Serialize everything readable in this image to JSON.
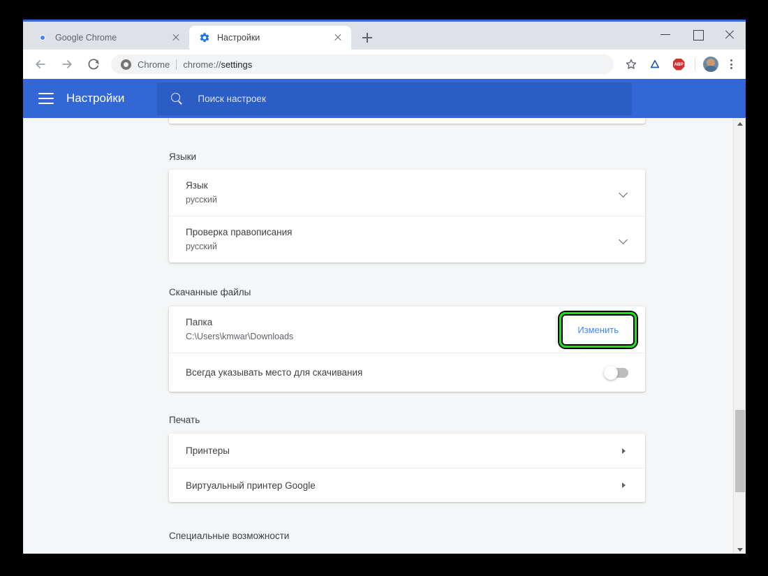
{
  "window": {
    "controls": {
      "minimize": "minimize-button",
      "maximize": "maximize-button",
      "close": "close-button"
    }
  },
  "tabs": [
    {
      "title": "Google Chrome",
      "favicon": "chrome-logo-icon",
      "active": false
    },
    {
      "title": "Настройки",
      "favicon": "gear-icon",
      "active": true
    }
  ],
  "newtab_label": "+",
  "toolbar": {
    "back": "back-arrow-icon",
    "forward": "forward-arrow-icon",
    "reload": "reload-icon",
    "omnibox": {
      "site_label": "Chrome",
      "url_prefix": "chrome://",
      "url_bold": "settings",
      "full_url": "chrome://settings"
    },
    "bookmark": "star-icon",
    "extension_icon": "blue-triangle-icon",
    "adblock_label": "ABP",
    "avatar": "profile-avatar",
    "menu": "three-dot-menu-icon"
  },
  "settings_header": {
    "menu_icon": "hamburger-icon",
    "title": "Настройки",
    "search_icon": "search-icon",
    "search_placeholder": "Поиск настроек"
  },
  "sections": {
    "languages": {
      "heading": "Языки",
      "rows": [
        {
          "label": "Язык",
          "sub": "русский",
          "control": "chevron-down-icon"
        },
        {
          "label": "Проверка правописания",
          "sub": "русский",
          "control": "chevron-down-icon"
        }
      ]
    },
    "downloads": {
      "heading": "Скачанные файлы",
      "folder_label": "Папка",
      "folder_path": "C:\\Users\\kmwar\\Downloads",
      "change_button": "Изменить",
      "ask_label": "Всегда указывать место для скачивания",
      "ask_toggle_state": "off"
    },
    "printing": {
      "heading": "Печать",
      "rows": [
        {
          "label": "Принтеры",
          "control": "chevron-right-icon"
        },
        {
          "label": "Виртуальный принтер Google",
          "control": "chevron-right-icon"
        }
      ]
    },
    "accessibility": {
      "heading": "Специальные возможности"
    }
  },
  "colors": {
    "header_blue": "#3367d6",
    "search_blue": "#2c5dc4",
    "link_blue": "#4285f4",
    "highlight_green": "#1ae01a",
    "page_bg": "#f5f6f7",
    "card_white": "#ffffff"
  }
}
